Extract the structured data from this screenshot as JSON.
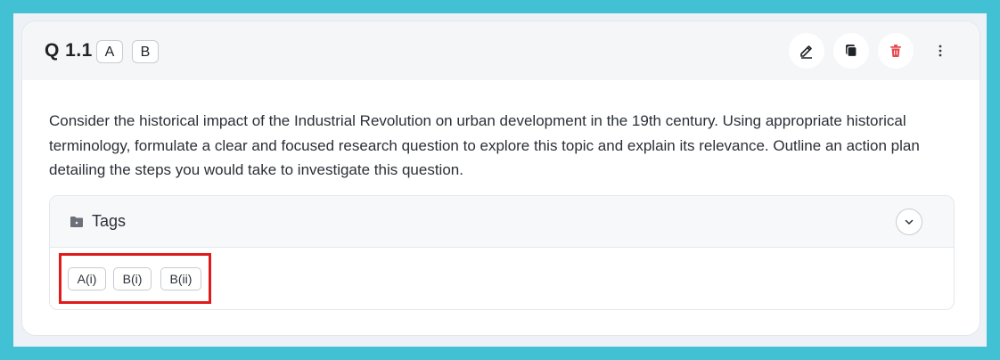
{
  "question": {
    "number": "Q 1.1",
    "parts": [
      "A",
      "B"
    ],
    "text": "Consider the historical impact of the Industrial Revolution on urban development in the 19th century. Using appropriate historical terminology, formulate a clear and focused research question to explore this topic and explain its relevance. Outline an action plan detailing the steps you would take to investigate this question."
  },
  "actions": {
    "edit_icon": "pencil-icon",
    "copy_icon": "copy-icon",
    "delete_icon": "trash-icon",
    "more_icon": "vertical-dots-icon",
    "delete_color": "#e5484d"
  },
  "tags": {
    "label": "Tags",
    "items": [
      "A(i)",
      "B(i)",
      "B(ii)"
    ],
    "highlight_color": "#e01b1b"
  },
  "colors": {
    "background": "#41c1d3",
    "card": "#ffffff",
    "header": "#f5f6f8"
  }
}
